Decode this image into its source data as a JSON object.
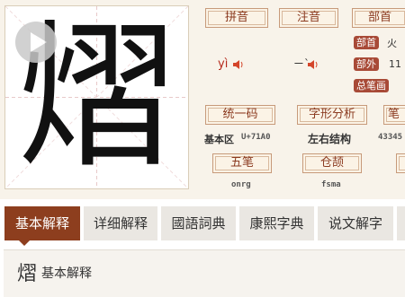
{
  "character": "熠",
  "icons": {
    "play": "play-icon",
    "speaker": "speaker-icon"
  },
  "colors": {
    "accent": "#8d3e1e",
    "label_text": "#8b3a1f",
    "pinyin": "#b52a1c",
    "tag_bg": "#a84a37"
  },
  "info": {
    "pinyin_label": "拼音",
    "pinyin_value": "yì",
    "zhuyin_label": "注音",
    "zhuyin_value": "ㄧˋ",
    "radical_label": "部首",
    "radical_tag": "部首",
    "radical_value": "火",
    "outer_strokes_tag": "部外",
    "outer_strokes_value": "11",
    "total_strokes_tag": "总笔画",
    "unicode_label": "统一码",
    "unicode_block": "基本区",
    "unicode_value": "U+71A0",
    "structure_label": "字形分析",
    "structure_value": "左右结构",
    "stroke_order_label": "笔",
    "stroke_order_value": "43345",
    "wubi_label": "五笔",
    "wubi_value": "onrg",
    "cangjie_label": "仓颉",
    "cangjie_value": "fsma"
  },
  "tabs": [
    {
      "label": "基本解释",
      "active": true
    },
    {
      "label": "详细解释",
      "active": false
    },
    {
      "label": "國語詞典",
      "active": false
    },
    {
      "label": "康熙字典",
      "active": false
    },
    {
      "label": "说文解字",
      "active": false
    }
  ],
  "section": {
    "char": "熠",
    "title": "基本解释"
  }
}
